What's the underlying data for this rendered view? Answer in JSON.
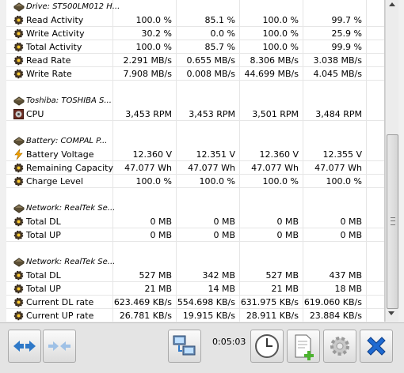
{
  "sections": [
    {
      "header": "Drive: ST500LM012 H...",
      "header_icon": "drive-icon",
      "rows": [
        {
          "label": "Read Activity",
          "icon": "gear-icon",
          "values": [
            "100.0 %",
            "85.1 %",
            "100.0 %",
            "99.7 %"
          ]
        },
        {
          "label": "Write Activity",
          "icon": "gear-icon",
          "values": [
            "30.2 %",
            "0.0 %",
            "100.0 %",
            "25.9 %"
          ]
        },
        {
          "label": "Total Activity",
          "icon": "gear-icon",
          "values": [
            "100.0 %",
            "85.7 %",
            "100.0 %",
            "99.9 %"
          ]
        },
        {
          "label": "Read Rate",
          "icon": "gear-icon",
          "values": [
            "2.291 MB/s",
            "0.655 MB/s",
            "8.306 MB/s",
            "3.038 MB/s"
          ]
        },
        {
          "label": "Write Rate",
          "icon": "gear-icon",
          "values": [
            "7.908 MB/s",
            "0.008 MB/s",
            "44.699 MB/s",
            "4.045 MB/s"
          ]
        }
      ]
    },
    {
      "header": "Toshiba: TOSHIBA S...",
      "header_icon": "chip-icon",
      "rows": [
        {
          "label": "CPU",
          "icon": "fan-icon",
          "values": [
            "3,453 RPM",
            "3,453 RPM",
            "3,501 RPM",
            "3,484 RPM"
          ]
        }
      ]
    },
    {
      "header": "Battery: COMPAL P...",
      "header_icon": "chip-icon",
      "rows": [
        {
          "label": "Battery Voltage",
          "icon": "lightning-icon",
          "values": [
            "12.360 V",
            "12.351 V",
            "12.360 V",
            "12.355 V"
          ]
        },
        {
          "label": "Remaining Capacity",
          "icon": "gear-icon",
          "values": [
            "47.077 Wh",
            "47.077 Wh",
            "47.077 Wh",
            "47.077 Wh"
          ]
        },
        {
          "label": "Charge Level",
          "icon": "gear-icon",
          "values": [
            "100.0 %",
            "100.0 %",
            "100.0 %",
            "100.0 %"
          ]
        }
      ]
    },
    {
      "header": "Network: RealTek Se...",
      "header_icon": "chip-icon",
      "rows": [
        {
          "label": "Total DL",
          "icon": "gear-icon",
          "values": [
            "0 MB",
            "0 MB",
            "0 MB",
            "0 MB"
          ]
        },
        {
          "label": "Total UP",
          "icon": "gear-icon",
          "values": [
            "0 MB",
            "0 MB",
            "0 MB",
            "0 MB"
          ]
        }
      ]
    },
    {
      "header": "Network: RealTek Se...",
      "header_icon": "chip-icon",
      "rows": [
        {
          "label": "Total DL",
          "icon": "gear-icon",
          "values": [
            "527 MB",
            "342 MB",
            "527 MB",
            "437 MB"
          ]
        },
        {
          "label": "Total UP",
          "icon": "gear-icon",
          "values": [
            "21 MB",
            "14 MB",
            "21 MB",
            "18 MB"
          ]
        },
        {
          "label": "Current DL rate",
          "icon": "gear-icon",
          "values": [
            "623.469 KB/s",
            "554.698 KB/s",
            "631.975 KB/s",
            "619.060 KB/s"
          ]
        },
        {
          "label": "Current UP rate",
          "icon": "gear-icon",
          "values": [
            "26.781 KB/s",
            "19.915 KB/s",
            "28.911 KB/s",
            "23.884 KB/s"
          ]
        }
      ]
    }
  ],
  "toolbar": {
    "timer": "0:05:03",
    "buttons": [
      "expand-arrows-icon",
      "collapse-arrows-icon",
      "network-computers-icon",
      "clock-icon",
      "add-document-icon",
      "settings-gear-icon",
      "close-x-icon"
    ]
  },
  "colors": {
    "accent_blue": "#2f79c8",
    "close_blue": "#1f6ad1"
  }
}
